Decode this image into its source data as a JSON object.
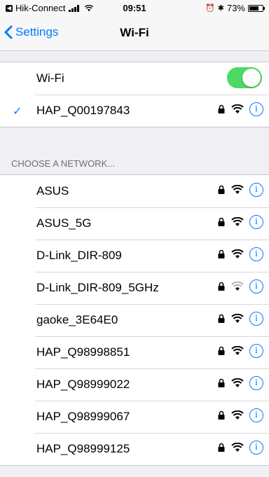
{
  "status": {
    "app": "Hik-Connect",
    "time": "09:51",
    "battery": "73%",
    "battery_level": 0.73
  },
  "nav": {
    "back_label": "Settings",
    "title": "Wi-Fi"
  },
  "wifi_toggle": {
    "label": "Wi-Fi",
    "on": true
  },
  "current_network": {
    "name": "HAP_Q00197843"
  },
  "section_header": "CHOOSE A NETWORK...",
  "networks": [
    {
      "name": "ASUS"
    },
    {
      "name": "ASUS_5G"
    },
    {
      "name": "D-Link_DIR-809"
    },
    {
      "name": "D-Link_DIR-809_5GHz"
    },
    {
      "name": "gaoke_3E64E0"
    },
    {
      "name": "HAP_Q98998851"
    },
    {
      "name": "HAP_Q98999022"
    },
    {
      "name": "HAP_Q98999067"
    },
    {
      "name": "HAP_Q98999125"
    }
  ],
  "colors": {
    "accent": "#007aff",
    "toggle_on": "#4cd964"
  }
}
